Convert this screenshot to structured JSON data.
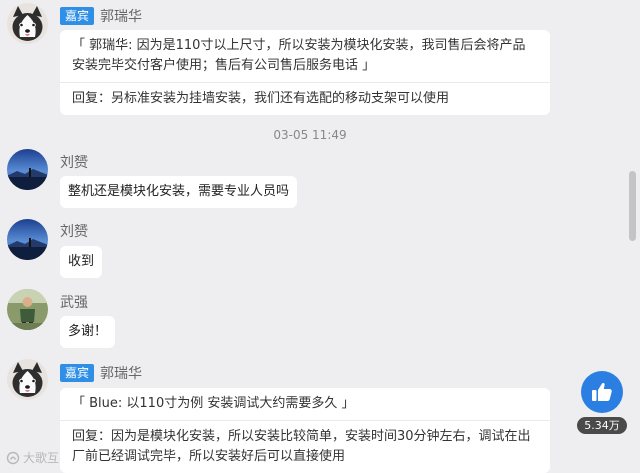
{
  "messages": [
    {
      "badge": "嘉宾",
      "name": "郭瑞华",
      "quote": "「 郭瑞华: 因为是110寸以上尺寸，所以安装为模块化安装，我司售后会将产品安装完毕交付客户使用；售后有公司售后服务电话 」",
      "reply": "回复：另标准安装为挂墙安装，我们还有选配的移动支架可以使用"
    },
    {
      "time": "03-05 11:49"
    },
    {
      "name": "刘赟",
      "text": "整机还是模块化安装，需要专业人员吗"
    },
    {
      "name": "刘赟",
      "text": "收到"
    },
    {
      "name": "武强",
      "text": "多谢！"
    },
    {
      "badge": "嘉宾",
      "name": "郭瑞华",
      "quote": "「 Blue: 以110寸为例 安装调试大约需要多久 」",
      "reply": "回复：因为是模块化安装，所以安装比较简单，安装时间30分钟左右，调试在出厂前已经调试完毕，所以安装好后可以直接使用"
    }
  ],
  "like": {
    "icon": "thumbs-up-icon",
    "count": "5.34万"
  },
  "watermark": "大歌互",
  "colors": {
    "badge": "#2f8fe6",
    "like": "#2b7fe3",
    "background": "#eeeef0"
  }
}
